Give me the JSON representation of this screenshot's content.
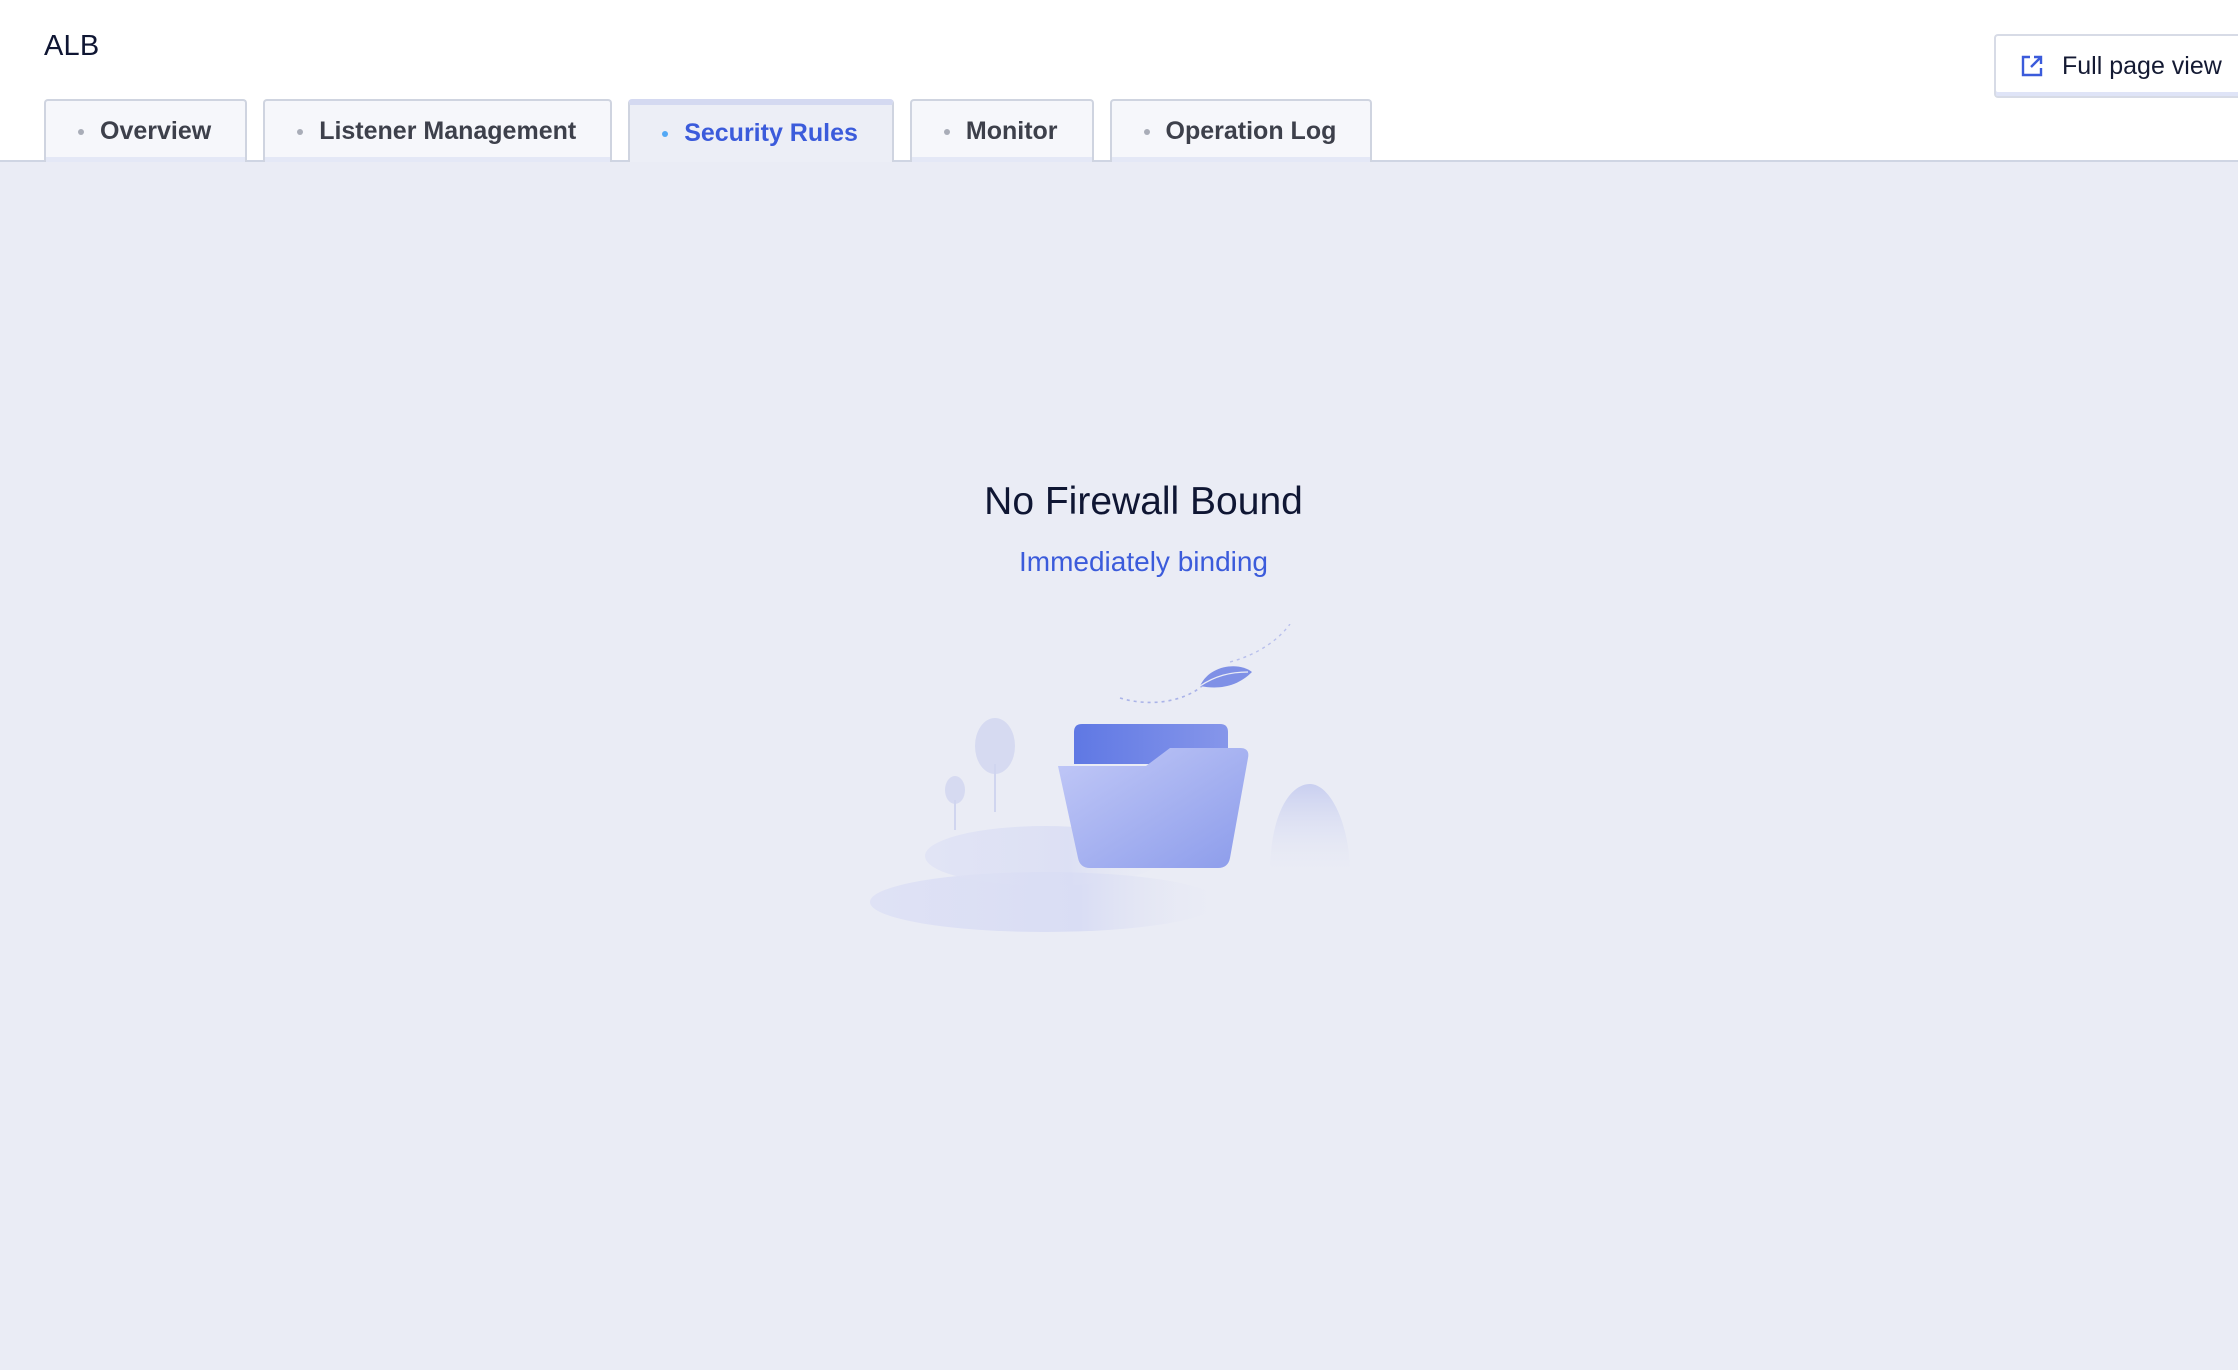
{
  "app": {
    "title": "ALB"
  },
  "toolbar": {
    "full_page_label": "Full page view",
    "full_page_icon": "external-link-icon"
  },
  "tabs": [
    {
      "label": "Overview",
      "active": false
    },
    {
      "label": "Listener Management",
      "active": false
    },
    {
      "label": "Security Rules",
      "active": true
    },
    {
      "label": "Monitor",
      "active": false
    },
    {
      "label": "Operation Log",
      "active": false
    }
  ],
  "empty_state": {
    "title": "No Firewall Bound",
    "action_label": "Immediately binding",
    "illustration_icon": "empty-folder-illustration"
  },
  "colors": {
    "accent": "#3b5bdb",
    "content_background": "#eaecf5",
    "active_tab_dot": "#53a8f5"
  }
}
